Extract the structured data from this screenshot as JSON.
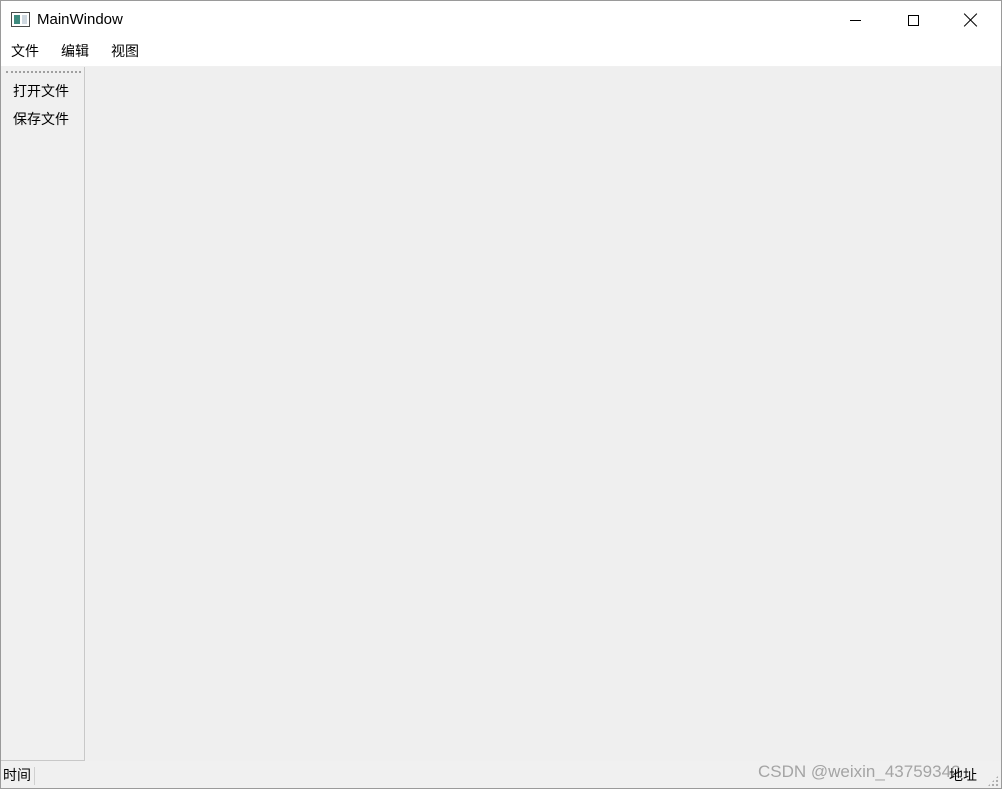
{
  "window": {
    "title": "MainWindow",
    "app_icon": "window-icon",
    "controls": {
      "minimize_icon": "minimize-icon",
      "maximize_icon": "maximize-icon",
      "close_icon": "close-icon"
    }
  },
  "menubar": {
    "items": [
      {
        "label": "文件"
      },
      {
        "label": "编辑"
      },
      {
        "label": "视图"
      }
    ]
  },
  "toolbar": {
    "items": [
      {
        "label": "打开文件"
      },
      {
        "label": "保存文件"
      }
    ]
  },
  "statusbar": {
    "left_label": "时间",
    "right_label": "地址"
  },
  "watermark": "CSDN @weixin_43759342"
}
